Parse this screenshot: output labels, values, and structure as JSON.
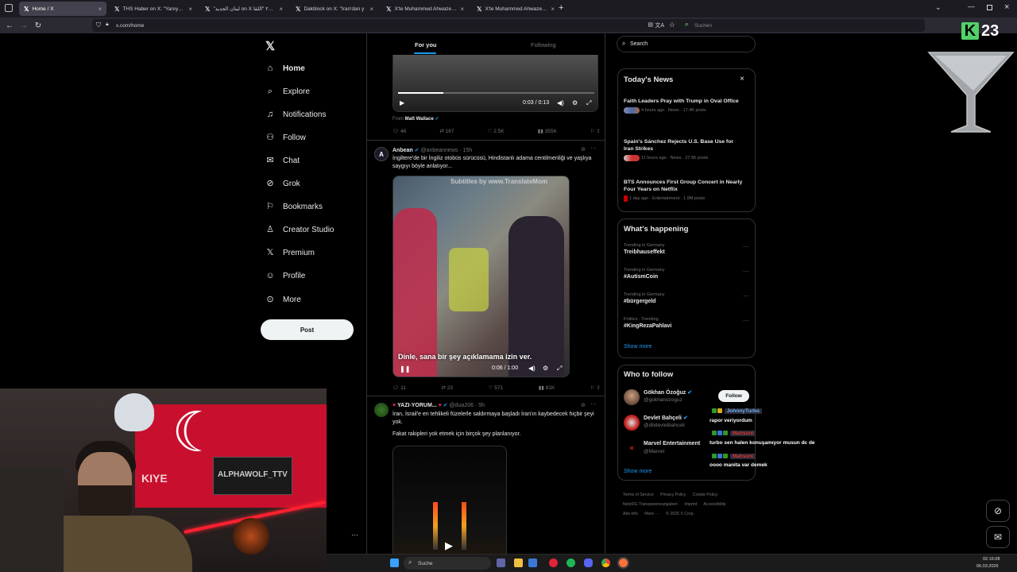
{
  "browser": {
    "tabs": [
      {
        "title": "Home / X",
        "active": true
      },
      {
        "title": "THS Haber on X: \"Yanıyor 🔥 İr\"",
        "active": false
      },
      {
        "title": "\"لبنان الجديد on X ٢٠٢٥ \"اللقا",
        "active": false
      },
      {
        "title": "Daktilock on X: \"İran'dan y",
        "active": false
      },
      {
        "title": "X'te Muhammed Ahwaze: \"Zev",
        "active": false
      },
      {
        "title": "X'te Muhammed Ahwaze: \"Test",
        "active": false
      }
    ],
    "url": "x.com/home",
    "search_placeholder": "Suchen"
  },
  "logo": {
    "number": "23"
  },
  "nav": {
    "items": [
      {
        "label": "Home",
        "icon": "home-icon"
      },
      {
        "label": "Explore",
        "icon": "search-icon"
      },
      {
        "label": "Notifications",
        "icon": "bell-icon"
      },
      {
        "label": "Follow",
        "icon": "add-person-icon"
      },
      {
        "label": "Chat",
        "icon": "mail-icon"
      },
      {
        "label": "Grok",
        "icon": "grok-icon"
      },
      {
        "label": "Bookmarks",
        "icon": "bookmark-icon"
      },
      {
        "label": "Creator Studio",
        "icon": "creator-icon"
      },
      {
        "label": "Premium",
        "icon": "x-icon"
      },
      {
        "label": "Profile",
        "icon": "person-icon"
      },
      {
        "label": "More",
        "icon": "more-icon"
      }
    ],
    "post_label": "Post"
  },
  "timeline": {
    "tabs": [
      "For you",
      "Following"
    ],
    "post1": {
      "video_time": "0:03 / 0:13",
      "from_label": "From",
      "from_name": "Matt Wallace",
      "actions": [
        "46",
        "167",
        "2.5K",
        "355K"
      ]
    },
    "post2": {
      "name": "Anbean",
      "handle": "@anbeannews",
      "time": "· 15h",
      "text": "İngiltere'de bir İngiliz otobüs sürücüsü, Hindistanlı adama centilmenliği ve yaşlıya saygıyı böyle anlatıyor...",
      "subtitle_top": "Subtitles by www.TranslateMom",
      "subtitle_bottom": "Dinle, sana bir şey açıklamama izin ver.",
      "video_time": "0:06 / 1:00",
      "actions": [
        "11",
        "23",
        "571",
        "81K"
      ]
    },
    "post3": {
      "name": "YAZI-YORUM...",
      "handle": "@dua206",
      "time": "· 5h",
      "text1": "İran, İsrail'e en tehlikeli füzelerle saldırmaya başladı İran'ın kaybedecek hiçbir şeyi yok.",
      "text2": "Fakat rakipleri yok etmek için birçok şey planlanıyor."
    }
  },
  "right": {
    "search_placeholder": "Search",
    "todays_news": {
      "title": "Today's News",
      "items": [
        {
          "title": "Faith Leaders Pray with Trump in Oval Office",
          "meta": "4 hours ago · News · 17.4K posts"
        },
        {
          "title": "Spain's Sánchez Rejects U.S. Base Use for Iran Strikes",
          "meta": "11 hours ago · News · 27.5K posts"
        },
        {
          "title": "BTS Announces First Group Concert in Nearly Four Years on Netflix",
          "meta": "1 day ago · Entertainment · 1.9M posts"
        }
      ]
    },
    "whats_happening": {
      "title": "What's happening",
      "items": [
        {
          "context": "Trending in Germany",
          "name": "Treibhauseffekt"
        },
        {
          "context": "Trending in Germany",
          "name": "#AutismCoin"
        },
        {
          "context": "Trending in Germany",
          "name": "#bürgergeld"
        },
        {
          "context": "Politics · Trending",
          "name": "#KingRezaPahlavi"
        }
      ],
      "show_more": "Show more"
    },
    "who_to_follow": {
      "title": "Who to follow",
      "items": [
        {
          "name": "Gökhan Özoğuz",
          "handle": "@gokhanozoguz"
        },
        {
          "name": "Devlet Bahçeli",
          "handle": "@dbdevletbahceli"
        },
        {
          "name": "Marvel Entertainment",
          "handle": "@Marvel"
        }
      ],
      "follow_label": "Follow",
      "show_more": "Show more"
    },
    "footer": [
      "Terms of Service",
      "Privacy Policy",
      "Cookie Policy",
      "NetzDG Transparenzangaben",
      "Imprint",
      "Accessibility",
      "Ads info",
      "More ···",
      "© 2026 X Corp."
    ]
  },
  "chat_overlay": [
    {
      "user": "JohnnyTurbo",
      "message": "rapor veriyordum"
    },
    {
      "user": "Mahsuni",
      "message": "turbo sen halen konuşamıyor musun dc de"
    },
    {
      "user": "Mahsuni",
      "message": "oooo manita var demek"
    }
  ],
  "webcam": {
    "poster_text": "ALPHAWOLF_TTV",
    "flag_text": "KIYE"
  },
  "taskbar": {
    "search_label": "Suche",
    "time": "02:16:08",
    "date": "06.03.2026"
  },
  "colors": {
    "accent": "#1d9bf0",
    "background": "#000000",
    "border": "#2f3336",
    "muted": "#71767b",
    "logo_green": "#52d16a"
  }
}
